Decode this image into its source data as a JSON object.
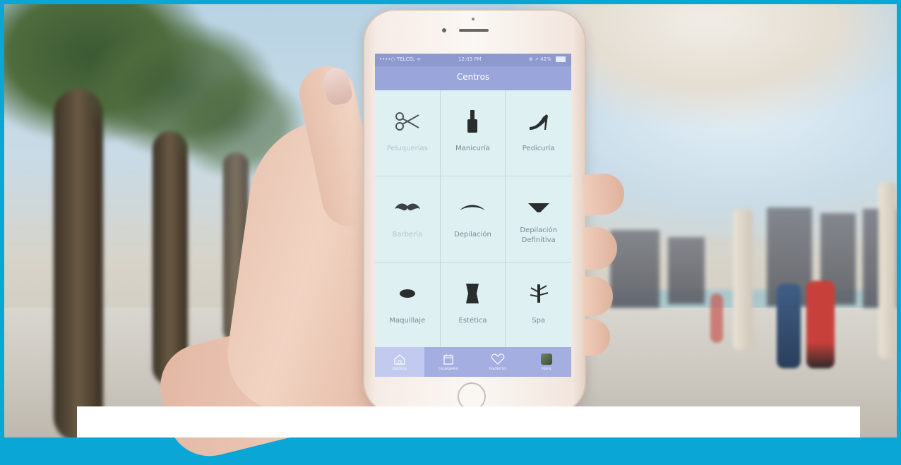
{
  "status_bar": {
    "carrier": "••••○ TELCEL ᯤ",
    "time": "12:03 PM",
    "battery": "⊕ ↗ 42%"
  },
  "app": {
    "title": "Centros"
  },
  "categories": [
    {
      "label": "Peluquerías",
      "icon": "scissors-icon",
      "active": false
    },
    {
      "label": "Manicuría",
      "icon": "nail-polish-icon",
      "active": true
    },
    {
      "label": "Pedicuría",
      "icon": "high-heel-icon",
      "active": true
    },
    {
      "label": "Barbería",
      "icon": "mustache-icon",
      "active": false
    },
    {
      "label": "Depilación",
      "icon": "eyebrow-icon",
      "active": true
    },
    {
      "label": "Depilación Definitiva",
      "icon": "bikini-icon",
      "active": true
    },
    {
      "label": "Maquillaje",
      "icon": "lips-icon",
      "active": true
    },
    {
      "label": "Estética",
      "icon": "corset-icon",
      "active": true
    },
    {
      "label": "Spa",
      "icon": "bamboo-icon",
      "active": true
    }
  ],
  "tabs": [
    {
      "label": "CENTROS",
      "icon": "home-icon",
      "selected": true
    },
    {
      "label": "CALENDARIO",
      "icon": "calendar-icon",
      "selected": false
    },
    {
      "label": "FAVORITOS",
      "icon": "heart-icon",
      "selected": false
    },
    {
      "label": "PERFIL",
      "icon": "avatar-icon",
      "selected": false
    }
  ],
  "colors": {
    "accent": "#9aa6da",
    "screen_bg": "#dff0f3",
    "frame": "#0aa6d6"
  }
}
